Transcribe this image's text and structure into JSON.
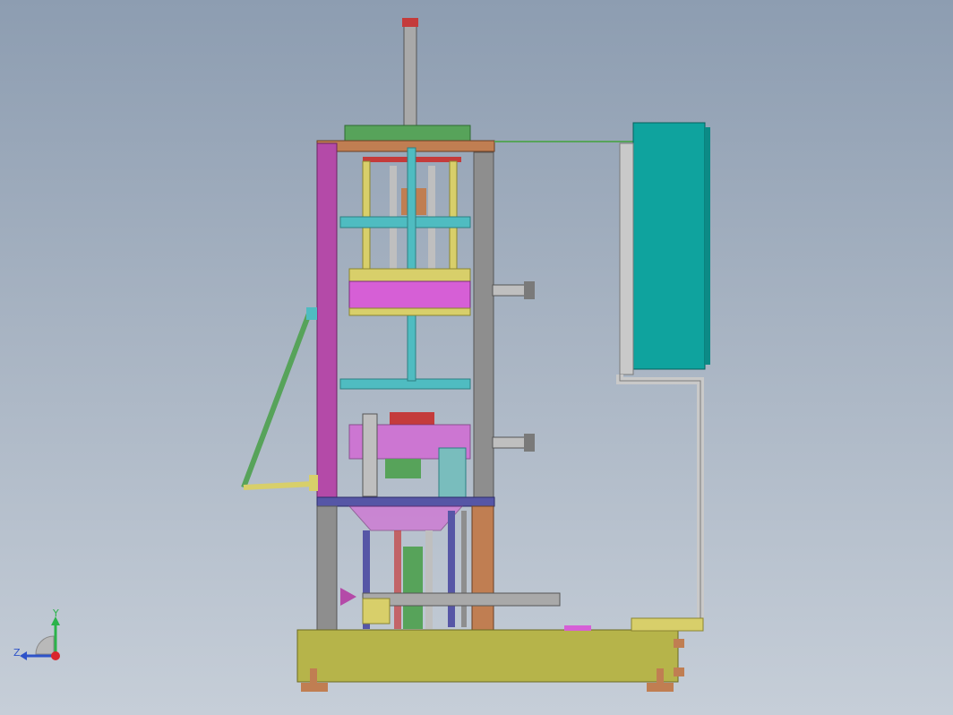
{
  "viewport": {
    "background_top": "#8d9db1",
    "background_bottom": "#c6ced8"
  },
  "model": {
    "colors": {
      "base": "#b6b44a",
      "frame_gray": "#8e8e8e",
      "frame_magenta": "#b44aa8",
      "frame_blue": "#5656a6",
      "frame_brown": "#c07e52",
      "crossbar_cyan": "#4fbcc1",
      "cabinet_teal": "#0fa39e",
      "arm_green": "#57a35a",
      "cylinder_gray": "#a9a9a9",
      "part_red": "#c43b3b",
      "part_pink": "#d65fd6",
      "part_yellow": "#d8cf6a"
    }
  },
  "triad": {
    "y_label": "Y",
    "z_label": "Z",
    "y_color": "#2bb34a",
    "z_color": "#2e53c9",
    "origin_color": "#d9262c"
  }
}
